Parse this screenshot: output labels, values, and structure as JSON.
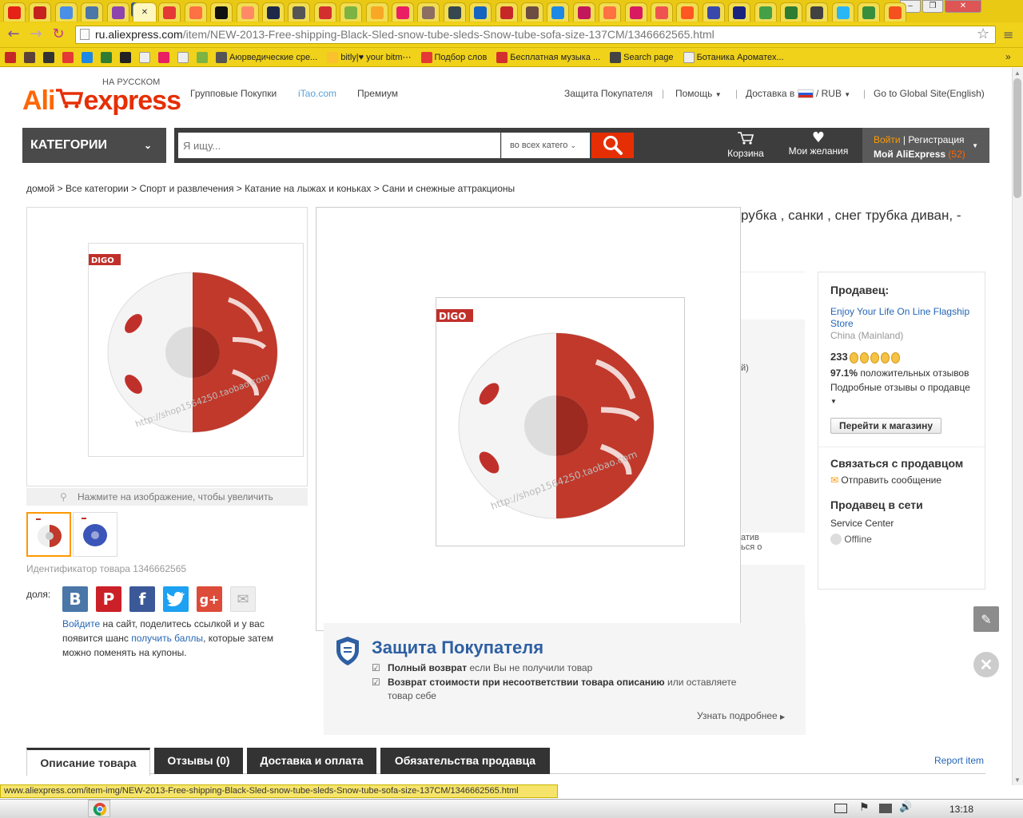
{
  "browser": {
    "url_host": "ru.aliexpress.com",
    "url_path": "/item/NEW-2013-Free-shipping-Black-Sled-snow-tube-sleds-Snow-tube-sofa-size-137CM/1346662565.html",
    "status_url": "www.aliexpress.com/item-img/NEW-2013-Free-shipping-Black-Sled-snow-tube-sleds-Snow-tube-sofa-size-137CM/1346662565.html",
    "tab_favicons": [
      "youtube-icon",
      "gmail-icon",
      "chrome-icon",
      "vk-icon",
      "puzzle-icon",
      "close-tab-icon",
      "ebay-icon",
      "seven-icon",
      "tiktok-icon",
      "sun-icon",
      "photoshop-icon",
      "soccer-icon",
      "two-icon",
      "plane-icon",
      "crown-icon",
      "arrows-icon",
      "tree-icon",
      "film-icon",
      "fe-icon",
      "tv-icon",
      "chess-icon",
      "fish-icon",
      "lips-icon",
      "paint-icon",
      "v-icon",
      "mail-icon",
      "lollipop-icon",
      "spiral-icon",
      "blue-icon",
      "grid-icon",
      "star-icon",
      "people-icon",
      "photo-icon",
      "arrow-icon",
      "blogger-icon"
    ],
    "bookmarks": [
      {
        "label": "",
        "icon": "k-icon"
      },
      {
        "label": "",
        "icon": "shield-icon"
      },
      {
        "label": "",
        "icon": "camera-icon"
      },
      {
        "label": "",
        "icon": "fruit-icon"
      },
      {
        "label": "",
        "icon": "plane-icon"
      },
      {
        "label": "",
        "icon": "f-icon"
      },
      {
        "label": "",
        "icon": "flower-icon"
      },
      {
        "label": "",
        "icon": "page-icon"
      },
      {
        "label": "",
        "icon": "globe-icon"
      },
      {
        "label": "",
        "icon": "page-icon"
      },
      {
        "label": "",
        "icon": "leaf-icon"
      },
      {
        "label": "Аюрведические сре...",
        "icon": "folder-icon"
      },
      {
        "label": "bitly|♥ your bitm⋯",
        "icon": "bitly-icon"
      },
      {
        "label": "Подбор слов",
        "icon": "chart-icon"
      },
      {
        "label": "Бесплатная музыка ...",
        "icon": "music-icon"
      },
      {
        "label": "Search page",
        "icon": "play-icon"
      },
      {
        "label": "Ботаника Ароматех...",
        "icon": "page-icon"
      }
    ],
    "bookmarks_more": "»"
  },
  "header": {
    "logo_ali": "Ali",
    "logo_express": "express",
    "logo_sub": "НА РУССКОМ",
    "links": [
      "Групповые Покупки",
      "iTao.com",
      "Премиум"
    ],
    "buyer_protection": "Защита Покупателя",
    "help": "Помощь",
    "delivery_to": "Доставка в",
    "currency": "/ RUB",
    "global_site": "Go to Global Site(English)",
    "categories": "КАТЕГОРИИ",
    "search_placeholder": "Я ищу...",
    "search_category": "во всех катего",
    "cart": "Корзина",
    "wishlist": "Мои желания",
    "login": "Войти",
    "register": "Регистрация",
    "my_ali": "Мой AliExpress",
    "my_ali_count": "(52)"
  },
  "breadcrumb": "домой > Все категории > Спорт и развлечения > Катание на лыжах и коньках > Сани и снежные аттракционы",
  "product": {
    "title_fragment": "рубка , санки , снег трубка диван, -",
    "brand_tag": "DIGO",
    "watermark": "http://shop1564250.taobao.com",
    "zoom_hint": "Нажмите на изображение, чтобы увеличить",
    "product_id": "Идентификатор товара 1346662565",
    "share_label": "доля:",
    "share_text_login": "Войдите",
    "share_text_1": " на сайт, поделитесь ссылкой и у вас появится шанс ",
    "share_text_link": "получить баллы",
    "share_text_2": ", которые затем можно поменять на купоны.",
    "mid_fragment_1": "й)",
    "mid_fragment_2": "атив",
    "mid_fragment_3": "ься о"
  },
  "seller": {
    "heading": "Продавец:",
    "store_name": "Enjoy Your Life On Line Flagship Store",
    "location": "China (Mainland)",
    "score": "233",
    "positive_pct": "97.1%",
    "positive_text": " положительных отзывов",
    "detailed": "Подробные отзывы о продавце",
    "go_store": "Перейти к магазину",
    "contact_heading": "Связаться с продавцом",
    "send_message": "Отправить сообщение",
    "online_heading": "Продавец в сети",
    "service_center": "Service Center",
    "status": "Offline"
  },
  "protection": {
    "title": "Защита Покупателя",
    "item1_bold": "Полный возврат",
    "item1_rest": " если Вы не получили товар",
    "item2_bold": "Возврат стоимости при несоответствии товара описанию",
    "item2_rest": " или оставляете товар себе",
    "learn_more": "Узнать подробнее"
  },
  "tabs": [
    "Описание товара",
    "Отзывы (0)",
    "Доставка и оплата",
    "Обязательства продавца"
  ],
  "report": "Report item",
  "taskbar": {
    "clock": "13:18"
  }
}
